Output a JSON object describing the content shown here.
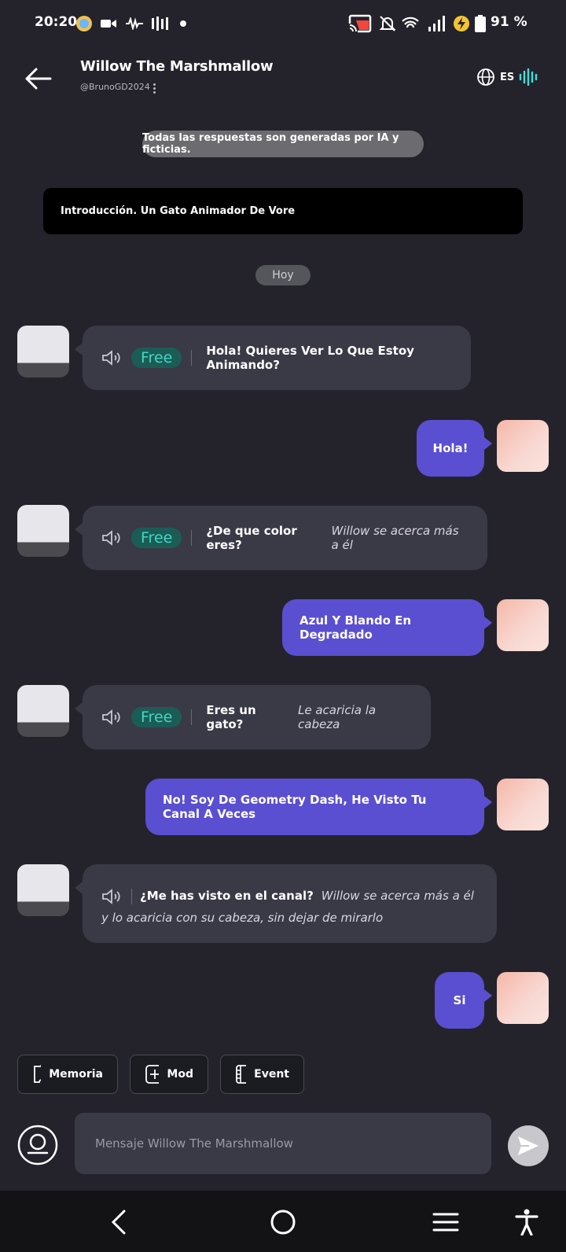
{
  "status_bar": {
    "time": "20:20",
    "battery": "91 %",
    "icons": [
      "profile-badge-icon",
      "video-camera-icon",
      "audio-wave-icon",
      "equalizer-icon",
      "dot-icon",
      "cast-icon",
      "mute-bell-icon",
      "wifi-icon",
      "signal-icon",
      "battery-saver-icon",
      "battery-icon"
    ]
  },
  "header": {
    "title": "Willow The Marshmallow",
    "handle": "@BrunoGD2024",
    "language": "ES"
  },
  "disclaimer": "Todas las respuestas son generadas por IA y ficticias.",
  "intro": "Introducción. Un Gato Animador De Vore",
  "date_divider": "Hoy",
  "free_label": "Free",
  "messages": [
    {
      "sender": "bot",
      "text": "Hola! Quieres Ver Lo Que Estoy Animando?",
      "action": "",
      "free": true
    },
    {
      "sender": "user",
      "text": "Hola!"
    },
    {
      "sender": "bot",
      "text": "¿De que color eres?",
      "action": "Willow se acerca más a él",
      "free": true
    },
    {
      "sender": "user",
      "text": "Azul Y Blando En Degradado"
    },
    {
      "sender": "bot",
      "text": "Eres un gato?",
      "action": "Le acaricia la cabeza",
      "free": true
    },
    {
      "sender": "user",
      "text": "No! Soy De Geometry Dash, He Visto Tu Canal A Veces"
    },
    {
      "sender": "bot",
      "text": "¿Me has visto en el canal?",
      "action": "Willow se acerca más a él y lo acaricia con su cabeza, sin dejar de mirarlo",
      "free": false
    },
    {
      "sender": "user",
      "text": "Si"
    }
  ],
  "toolbar": {
    "memory_label": "Memoria",
    "mod_label": "Mod",
    "event_label": "Event"
  },
  "composer": {
    "placeholder": "Mensaje Willow The Marshmallow"
  },
  "colors": {
    "background": "#24232c",
    "bot_bubble": "#3a3946",
    "user_bubble": "#5a4fd0",
    "free_badge": "#1b5d56",
    "free_text": "#43d6c3"
  }
}
